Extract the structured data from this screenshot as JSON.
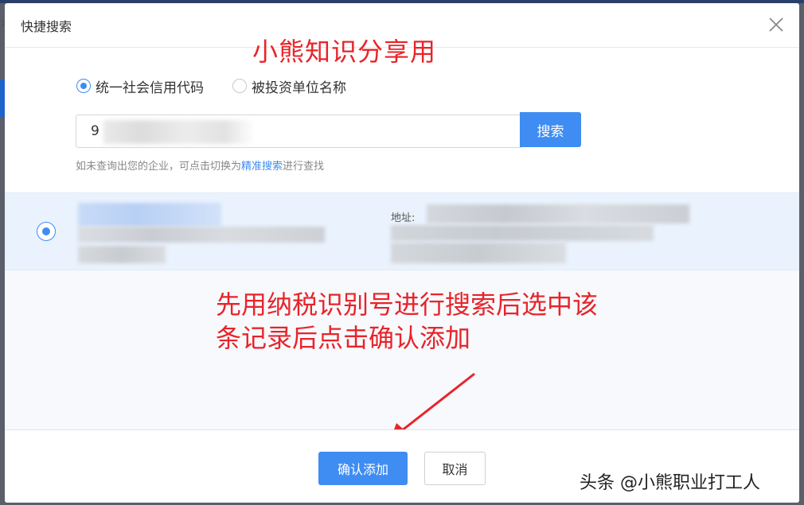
{
  "dialog": {
    "title": "快捷搜索"
  },
  "annotations": {
    "top": "小熊知识分享用",
    "middle_line1": "先用纳税识别号进行搜索后选中该",
    "middle_line2": "条记录后点击确认添加"
  },
  "search_type": {
    "options": [
      {
        "label": "统一社会信用代码",
        "selected": true
      },
      {
        "label": "被投资单位名称",
        "selected": false
      }
    ]
  },
  "search": {
    "value_visible": "9",
    "button_label": "搜索"
  },
  "hint": {
    "prefix": "如未查询出您的企业，可点击切换为",
    "link": "精准搜索",
    "suffix": "进行查找"
  },
  "result": {
    "address_label": "地址:",
    "selected": true
  },
  "footer": {
    "confirm_label": "确认添加",
    "cancel_label": "取消"
  },
  "watermark": "头条 @小熊职业打工人",
  "colors": {
    "accent": "#3f8cf2",
    "annotation_red": "#e8242a",
    "selected_row_bg": "#eaf2fd"
  }
}
